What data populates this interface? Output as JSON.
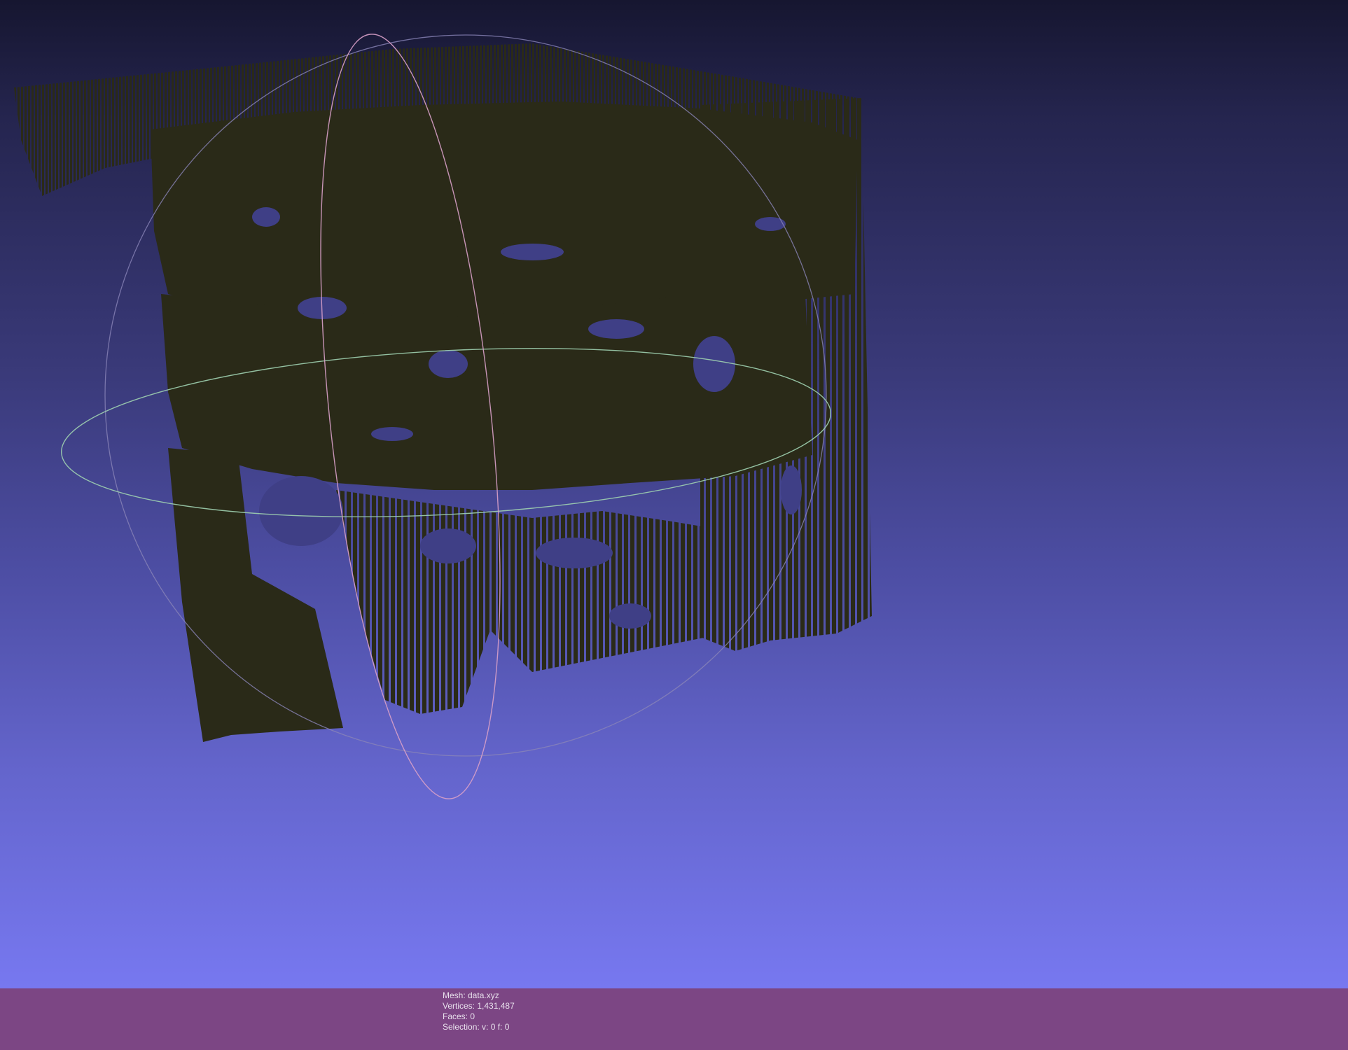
{
  "viewport": {
    "background_top": "#161630",
    "background_bottom": "#7778f0",
    "point_color": "#2a2a18",
    "trackball_colors": {
      "horizontal_ring": "#9fd0b0",
      "vertical_ring": "#d8a0c8",
      "outer_ring": "#8a84b8"
    }
  },
  "info": {
    "mesh": "Mesh: data.xyz",
    "vertices": "Vertices: 1,431,487",
    "faces": "Faces: 0",
    "selection": "Selection: v: 0 f: 0"
  },
  "info_bar_color": "#7c4684"
}
